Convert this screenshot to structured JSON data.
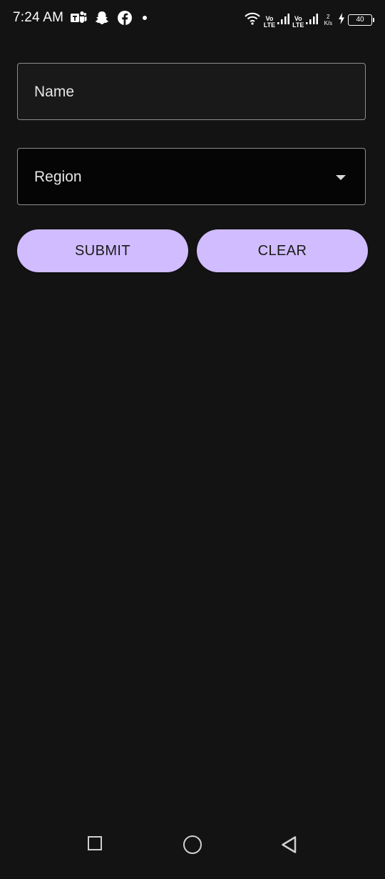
{
  "status_bar": {
    "time": "7:24 AM",
    "left_icons": [
      "teams-icon",
      "snapchat-icon",
      "facebook-icon",
      "notification-dot-icon"
    ],
    "sim1": {
      "top": "Vo",
      "bottom": "LTE"
    },
    "sim2": {
      "top": "Vo",
      "bottom": "LTE"
    },
    "speed": {
      "value": "2",
      "unit": "K/s"
    },
    "battery_level": "40",
    "charging": true
  },
  "form": {
    "name_label": "Name",
    "region_label": "Region"
  },
  "actions": {
    "submit_label": "SUBMIT",
    "clear_label": "CLEAR"
  },
  "colors": {
    "background": "#131313",
    "button": "#d0bcff",
    "button_text": "#1a1a1a",
    "field_border": "#8e8e8e"
  },
  "nav_bar": {
    "icons": [
      "recents-square-icon",
      "home-circle-icon",
      "back-triangle-icon"
    ]
  }
}
